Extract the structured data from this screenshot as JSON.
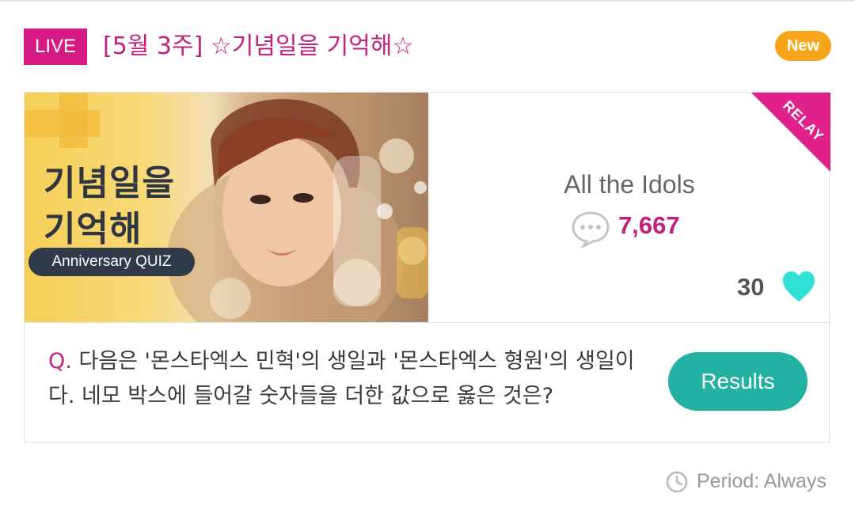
{
  "header": {
    "live_label": "LIVE",
    "title": "[5월 3주] ☆기념일을 기억해☆",
    "new_label": "New"
  },
  "thumbnail": {
    "title_line1": "기념일을",
    "title_line2": "기억해",
    "quiz_label": "Anniversary QUIZ"
  },
  "info": {
    "relay_label": "RELAY",
    "category": "All the Idols",
    "comment_count": "7,667",
    "likes_count": "30"
  },
  "question": {
    "prefix": "Q.",
    "text": "다음은 '몬스타엑스 민혁'의 생일과 '몬스타엑스 형원'의 생일이다. 네모 박스에 들어갈 숫자들을 더한 값으로 옳은 것은?"
  },
  "results_button": {
    "label": "Results"
  },
  "period": {
    "text": "Period: Always"
  },
  "colors": {
    "brand_pink": "#d41b84",
    "title_pink": "#c0207f",
    "new_orange": "#f7a51a",
    "results_teal": "#22b1a3",
    "heart_cyan": "#2ee0d6"
  },
  "icons": {
    "comment": "speech-bubble-icon",
    "heart": "heart-icon",
    "clock": "clock-icon"
  }
}
